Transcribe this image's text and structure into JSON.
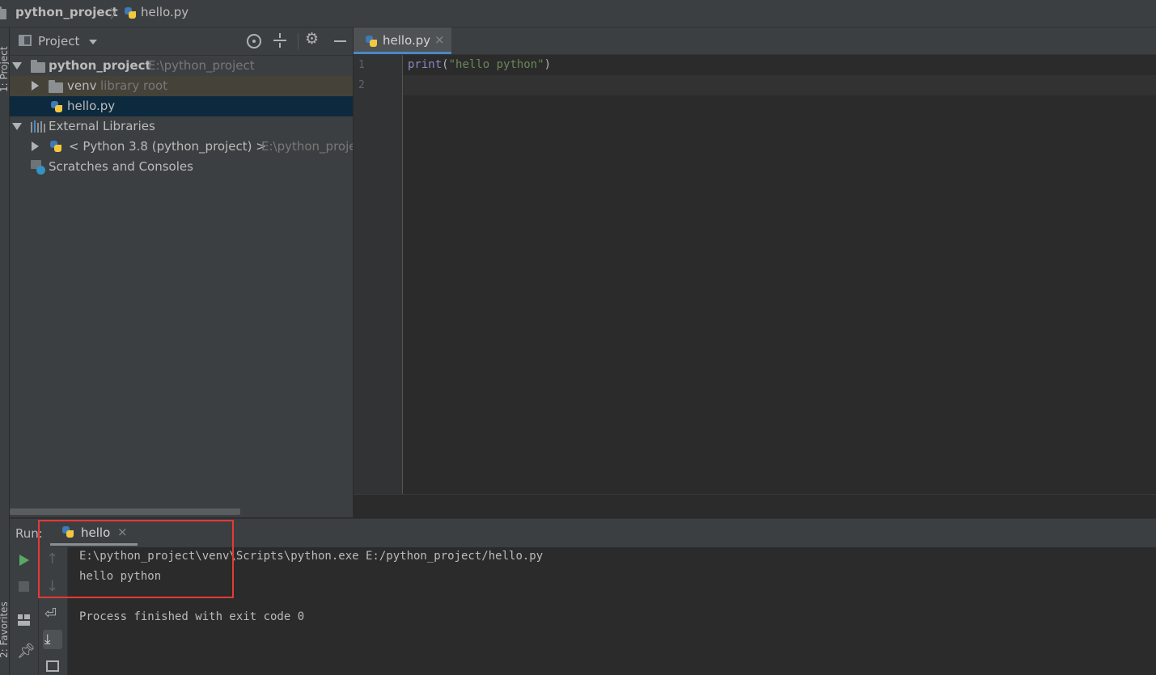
{
  "breadcrumb": {
    "project": "python_project",
    "separator": "〉",
    "file": "hello.py"
  },
  "left_strip": {
    "project_tab": "1: Project",
    "favorites_tab": "2: Favorites"
  },
  "project_panel": {
    "title": "Project",
    "tree": {
      "root_name": "python_project",
      "root_path": "E:\\python_project",
      "venv_name": "venv",
      "venv_hint": "library root",
      "file_name": "hello.py",
      "ext_libs": "External Libraries",
      "python_sdk": "< Python 3.8 (python_project) >",
      "python_sdk_path": "E:\\python_proje",
      "scratches": "Scratches and Consoles"
    }
  },
  "editor": {
    "tab_label": "hello.py",
    "line_numbers": [
      "1",
      "2"
    ],
    "code": {
      "func": "print",
      "open": "(",
      "string": "\"hello python\"",
      "close": ")"
    }
  },
  "run_panel": {
    "label": "Run:",
    "tab_label": "hello",
    "console": {
      "line1": "E:\\python_project\\venv\\Scripts\\python.exe E:/python_project/hello.py",
      "line2": "hello python",
      "line3": "Process finished with exit code 0"
    }
  },
  "colors": {
    "accent": "#4a88c7",
    "selection": "#0d293e",
    "venv_highlight": "#45423a",
    "string": "#6a8759",
    "run_green": "#59a869",
    "annotation_box": "#e53935"
  }
}
